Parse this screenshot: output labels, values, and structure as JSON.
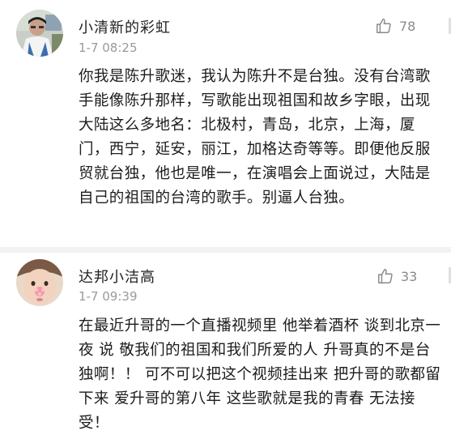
{
  "comments": [
    {
      "username": "小清新的彩虹",
      "timestamp": "1-7 08:25",
      "like_count": "78",
      "like_icon": "thumbs-up-icon",
      "body": "你我是陈升歌迷，我认为陈升不是台独。没有台湾歌手能像陈升那样，写歌能出现祖国和故乡字眼，出现大陆这么多地名：北极村，青岛，北京，上海，厦门，西宁，延安，丽江，加格达奇等等。即便他反服贸就台独，他也是唯一，在演唱会上面说过，大陆是自己的祖国的台湾的歌手。别逼人台独。"
    },
    {
      "username": "达邦小洁高",
      "timestamp": "1-7 09:39",
      "like_count": "33",
      "like_icon": "thumbs-up-icon",
      "body": "在最近升哥的一个直播视频里 他举着酒杯 谈到北京一夜 说 敬我们的祖国和我们所爱的人 升哥真的不是台独啊！！ 可不可以把这个视频挂出来 把升哥的歌都留下来 爱升哥的第八年 这些歌就是我的青春 无法接受！"
    }
  ]
}
